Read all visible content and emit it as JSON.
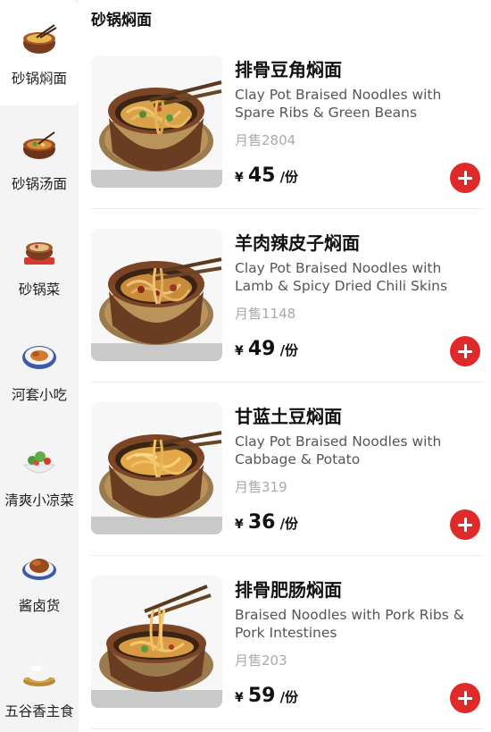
{
  "sidebar": {
    "items": [
      {
        "label": "砂锅焖面",
        "icon": "clay-pot-noodles-icon",
        "active": true
      },
      {
        "label": "砂锅汤面",
        "icon": "clay-pot-soup-noodles-icon",
        "active": false
      },
      {
        "label": "砂锅菜",
        "icon": "clay-pot-dish-icon",
        "active": false
      },
      {
        "label": "河套小吃",
        "icon": "snack-bowl-icon",
        "active": false
      },
      {
        "label": "清爽小凉菜",
        "icon": "cold-salad-icon",
        "active": false
      },
      {
        "label": "酱卤货",
        "icon": "braised-meat-icon",
        "active": false
      },
      {
        "label": "五谷香主食",
        "icon": "staple-rice-icon",
        "active": false
      }
    ]
  },
  "main": {
    "category_title": "砂锅焖面",
    "products": [
      {
        "name": "排骨豆角焖面",
        "description": "Clay Pot Braised Noodles with Spare Ribs & Green Beans",
        "sales": "月售2804",
        "currency": "¥",
        "price": "45",
        "unit": "/份"
      },
      {
        "name": "羊肉辣皮子焖面",
        "description": "Clay Pot Braised Noodles with Lamb & Spicy Dried Chili Skins",
        "sales": "月售1148",
        "currency": "¥",
        "price": "49",
        "unit": "/份"
      },
      {
        "name": "甘蓝土豆焖面",
        "description": "Clay Pot Braised Noodles with Cabbage & Potato",
        "sales": "月售319",
        "currency": "¥",
        "price": "36",
        "unit": "/份"
      },
      {
        "name": "排骨肥肠焖面",
        "description": "Braised Noodles with Pork Ribs & Pork Intestines",
        "sales": "月售203",
        "currency": "¥",
        "price": "59",
        "unit": "/份"
      }
    ]
  },
  "colors": {
    "accent": "#e02a2a",
    "sidebar_bg": "#f4f4f4",
    "muted_text": "#aaaaaa"
  }
}
